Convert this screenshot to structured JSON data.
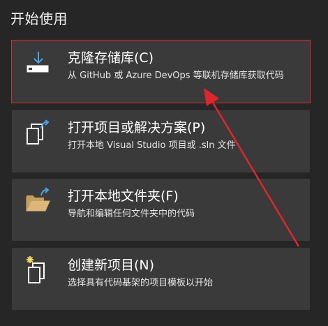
{
  "heading": "开始使用",
  "cards": [
    {
      "icon": "clone-download-icon",
      "title": "克隆存储库(C)",
      "desc": "从 GitHub 或 Azure DevOps 等联机存储库获取代码"
    },
    {
      "icon": "open-project-icon",
      "title": "打开项目或解决方案(P)",
      "desc": "打开本地 Visual Studio 项目或 .sln 文件"
    },
    {
      "icon": "open-folder-icon",
      "title": "打开本地文件夹(F)",
      "desc": "导航和编辑任何文件夹中的代码"
    },
    {
      "icon": "new-project-icon",
      "title": "创建新项目(N)",
      "desc": "选择具有代码基架的项目模板以开始"
    }
  ],
  "colors": {
    "background": "#262626",
    "card": "#3a3a3a",
    "highlight": "#e0262d",
    "icon_accent": "#4aa3e8",
    "folder": "#dcb67a",
    "sparkle": "#f5d65c"
  }
}
